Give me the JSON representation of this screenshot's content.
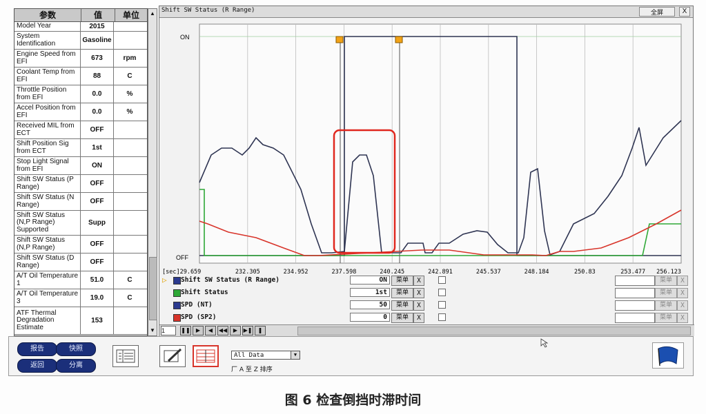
{
  "param_table": {
    "headers": [
      "参数",
      "值",
      "单位"
    ],
    "rows": [
      {
        "name": "Model Year",
        "value": "2015",
        "unit": ""
      },
      {
        "name": "System Identification",
        "value": "Gasoline",
        "unit": ""
      },
      {
        "name": "Engine Speed from EFI",
        "value": "673",
        "unit": "rpm"
      },
      {
        "name": "Coolant Temp from EFI",
        "value": "88",
        "unit": "C"
      },
      {
        "name": "Throttle Position from EFI",
        "value": "0.0",
        "unit": "%"
      },
      {
        "name": "Accel Position from EFI",
        "value": "0.0",
        "unit": "%"
      },
      {
        "name": "Received MIL from ECT",
        "value": "OFF",
        "unit": ""
      },
      {
        "name": "Shift Position Sig from ECT",
        "value": "1st",
        "unit": ""
      },
      {
        "name": "Stop Light Signal from EFI",
        "value": "ON",
        "unit": ""
      },
      {
        "name": "Shift SW Status (P Range)",
        "value": "OFF",
        "unit": ""
      },
      {
        "name": "Shift SW Status (N Range)",
        "value": "OFF",
        "unit": ""
      },
      {
        "name": "Shift SW Status (N,P Range) Supported",
        "value": "Supp",
        "unit": ""
      },
      {
        "name": "Shift SW Status (N,P Range)",
        "value": "OFF",
        "unit": ""
      },
      {
        "name": "Shift SW Status (D Range)",
        "value": "OFF",
        "unit": ""
      },
      {
        "name": "A/T Oil Temperature 1",
        "value": "51.0",
        "unit": "C"
      },
      {
        "name": "A/T Oil Temperature 3",
        "value": "19.0",
        "unit": "C"
      },
      {
        "name": "ATF Thermal Degradation Estimate",
        "value": "153",
        "unit": ""
      }
    ]
  },
  "graph": {
    "title": "Shift SW Status (R Range)",
    "fullscreen_label": "全屏",
    "close_label": "X",
    "y_on": "ON",
    "y_off": "OFF",
    "x_ticks": [
      "[sec]29.659",
      "232.305",
      "234.952",
      "237.598",
      "240.245",
      "242.891",
      "245.537",
      "248.184",
      "250.83",
      "253.477",
      "256.123"
    ]
  },
  "signals": [
    {
      "name": "Shift SW Status (R Range)",
      "value": "ON",
      "menu": "菜单",
      "x": "X",
      "color": "#2b3a8f"
    },
    {
      "name": "Shift Status",
      "value": "1st",
      "menu": "菜单",
      "x": "X",
      "color": "#2ea836"
    },
    {
      "name": "SPD (NT)",
      "value": "50",
      "menu": "菜单",
      "x": "X",
      "color": "#2b3a8f"
    },
    {
      "name": "SPD (SP2)",
      "value": "0",
      "menu": "菜单",
      "x": "X",
      "color": "#d8342a"
    }
  ],
  "right_menus": [
    "菜单",
    "菜单",
    "菜单",
    "菜单"
  ],
  "pager": {
    "page": "1"
  },
  "toolbar": {
    "buttons": [
      "报告",
      "快照",
      "返回",
      "分离"
    ],
    "select_value": "All Data",
    "sort_label": "厂 A 至 Z 排序"
  },
  "caption": "图 6 检查倒挡时滞时间",
  "colors": {
    "line_dark": "#2e3452",
    "line_red": "#d8342a",
    "line_green": "#2ea836",
    "highlight": "#e0271e",
    "accent_blue": "#1b2f7a"
  }
}
